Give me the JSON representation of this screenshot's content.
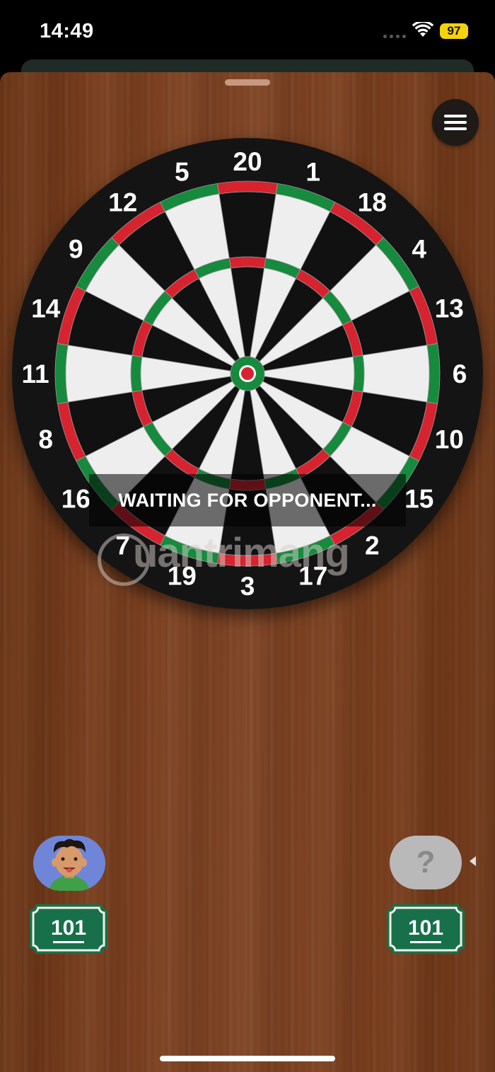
{
  "status_bar": {
    "time": "14:49",
    "battery": "97"
  },
  "game": {
    "status_message": "WAITING FOR OPPONENT...",
    "watermark": "uantrimang",
    "board_numbers": [
      "20",
      "1",
      "18",
      "4",
      "13",
      "6",
      "10",
      "15",
      "2",
      "17",
      "3",
      "19",
      "7",
      "16",
      "8",
      "11",
      "14",
      "9",
      "12",
      "5"
    ],
    "colors": {
      "wood": "#7c4020",
      "black": "#111111",
      "white": "#eeeeee",
      "red": "#d6232f",
      "green": "#168a3d",
      "score_green": "#17704a"
    }
  },
  "players": {
    "me": {
      "avatar": "boy-avatar",
      "score": "101"
    },
    "opponent": {
      "avatar": "unknown",
      "placeholder": "?",
      "score": "101"
    }
  },
  "icons": {
    "menu": "hamburger-menu-icon",
    "wifi": "wifi-icon",
    "signal": "signal-icon"
  }
}
